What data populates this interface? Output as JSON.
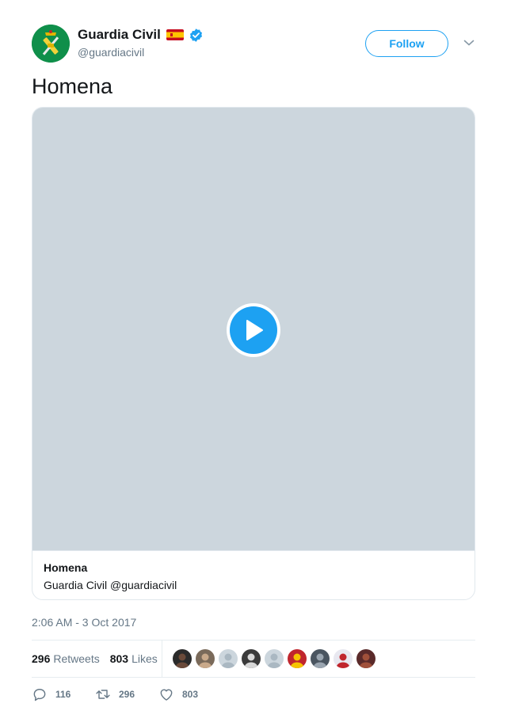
{
  "user": {
    "display_name": "Guardia Civil",
    "handle": "@guardiacivil",
    "verified": true
  },
  "follow_label": "Follow",
  "tweet": {
    "text": "Homena"
  },
  "media_card": {
    "title": "Homena",
    "subtitle": "Guardia Civil @guardiacivil"
  },
  "timestamp": "2:06 AM - 3 Oct 2017",
  "stats": {
    "retweets_count": "296",
    "retweets_label": "Retweets",
    "likes_count": "803",
    "likes_label": "Likes"
  },
  "liker_faces": [
    {
      "bg": "#2b2b2b",
      "fg": "#6a4a3a"
    },
    {
      "bg": "#7a6a5a",
      "fg": "#c9a98a"
    },
    {
      "bg": "#ccd6dd",
      "fg": "#aab8c2"
    },
    {
      "bg": "#3a3a3a",
      "fg": "#d8d8d8"
    },
    {
      "bg": "#ccd6dd",
      "fg": "#aab8c2"
    },
    {
      "bg": "#c0262d",
      "fg": "#f6c400"
    },
    {
      "bg": "#4a5560",
      "fg": "#9aa5b0"
    },
    {
      "bg": "#e8e8f0",
      "fg": "#c0262d"
    },
    {
      "bg": "#5a2a2a",
      "fg": "#a0503a"
    }
  ],
  "actions": {
    "replies": "116",
    "retweets": "296",
    "likes": "803"
  },
  "colors": {
    "accent": "#1da1f2",
    "text_secondary": "#657786",
    "video_placeholder": "#ccd6dd"
  }
}
